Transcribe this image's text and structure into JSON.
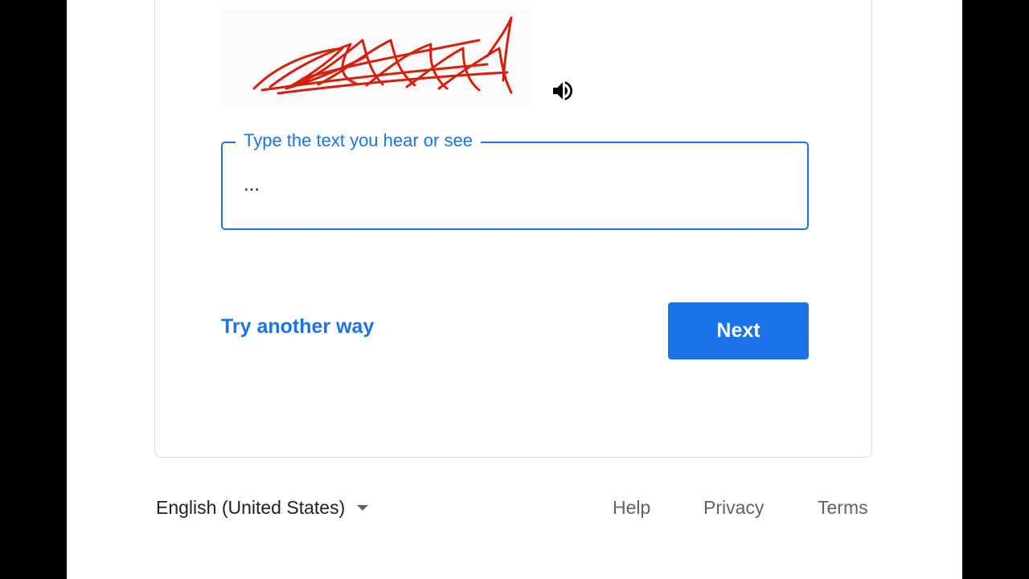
{
  "captcha": {
    "image_text": "cutsarmort",
    "audio_icon": "volume-up-icon"
  },
  "answer_field": {
    "label": "Type the text you hear or see",
    "value": "..."
  },
  "actions": {
    "try_another_label": "Try another way",
    "next_label": "Next"
  },
  "footer": {
    "language": "English (United States)",
    "language_icon": "caret-down-icon",
    "links": [
      "Help",
      "Privacy",
      "Terms"
    ]
  },
  "colors": {
    "accent": "#1a73e8",
    "captcha_ink": "#d4200c",
    "frame": "#000000"
  }
}
